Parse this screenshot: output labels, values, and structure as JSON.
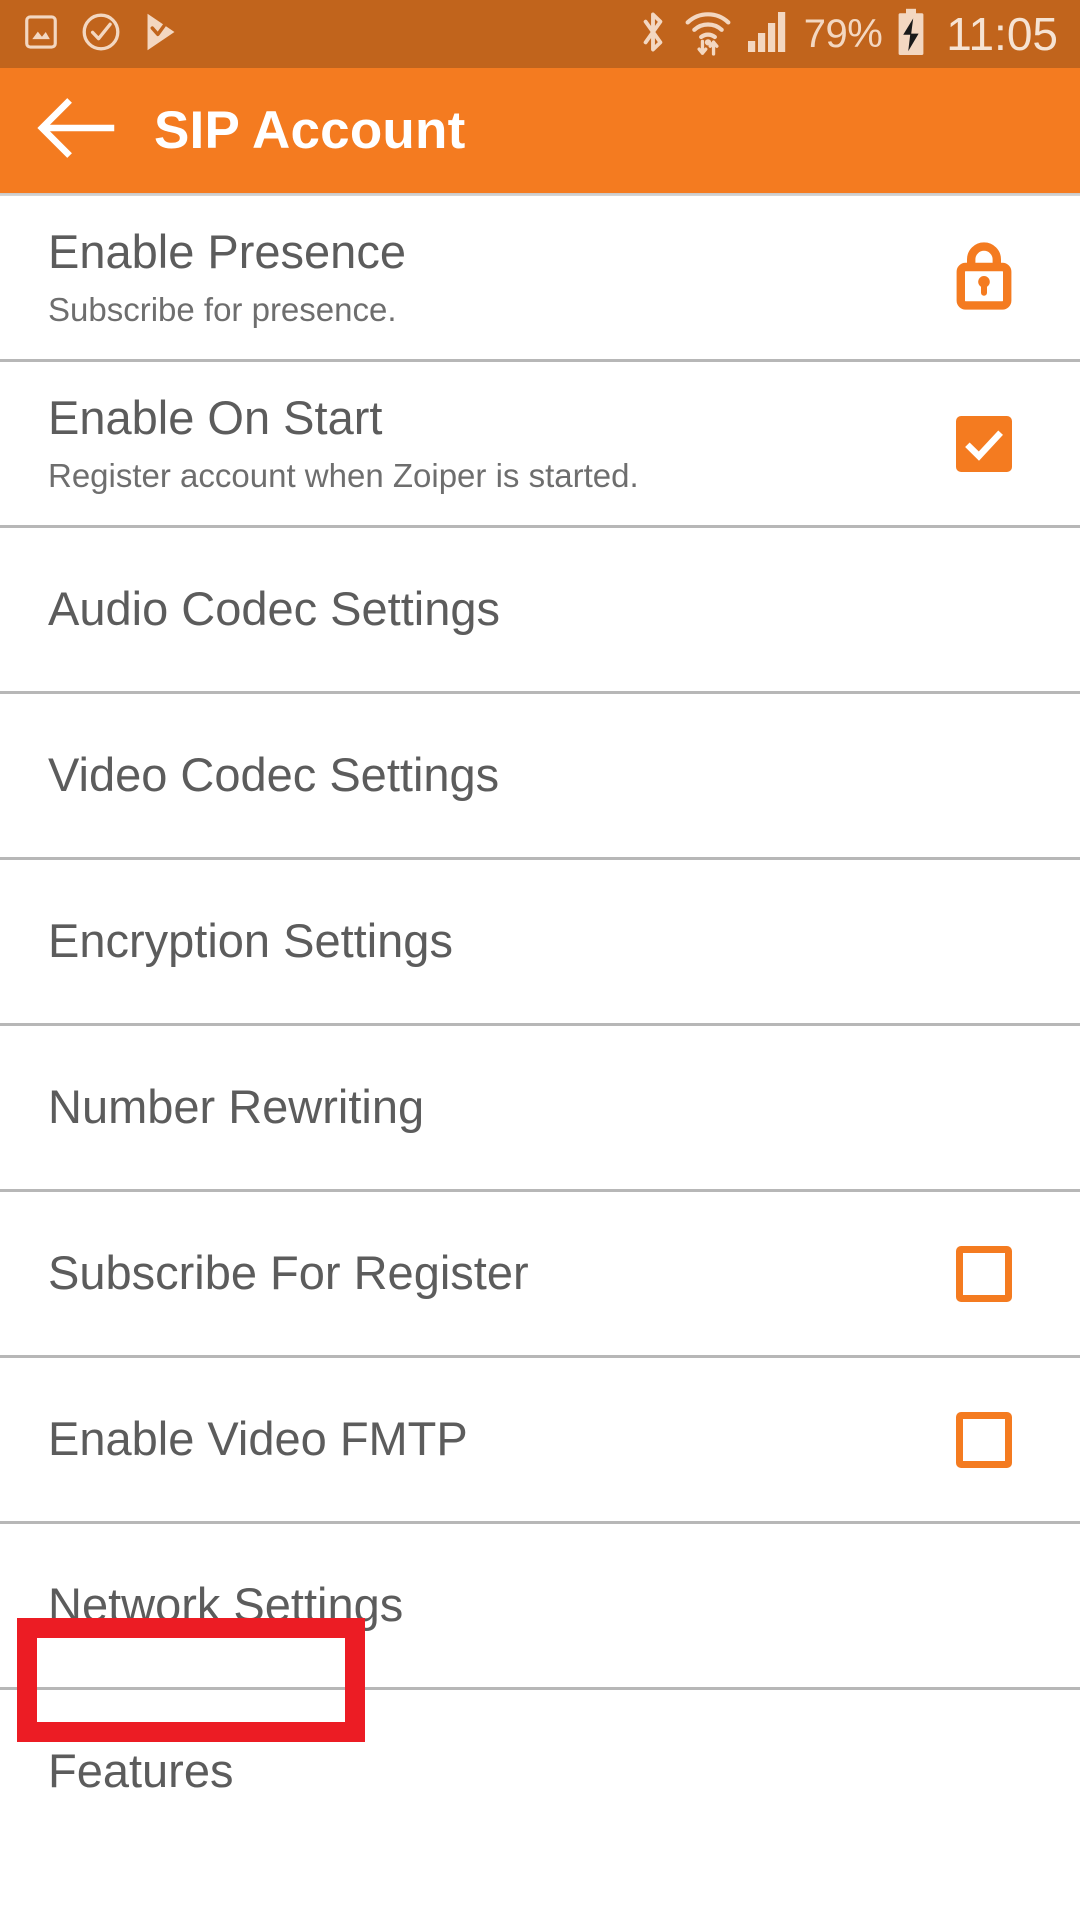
{
  "status_bar": {
    "background_color": "#c1641c",
    "icons_left": [
      "image-icon",
      "check-circle-icon",
      "play-store-check-icon"
    ],
    "icons_right": [
      "bluetooth-icon",
      "wifi-icon",
      "signal-bars-icon",
      "battery-charging-icon"
    ],
    "battery_percent": "79%",
    "clock": "11:05"
  },
  "app_bar": {
    "background_color": "#f47b20",
    "back_icon": "arrow-left-icon",
    "title": "SIP Account"
  },
  "accent_color": "#f47b20",
  "highlight_color": "#ec1c24",
  "settings": {
    "rows": [
      {
        "title": "Enable Presence",
        "subtitle": "Subscribe for presence.",
        "accessory": "lock",
        "locked": true
      },
      {
        "title": "Enable On Start",
        "subtitle": "Register account when Zoiper is started.",
        "accessory": "checkbox",
        "checked": true
      },
      {
        "title": "Audio Codec Settings",
        "subtitle": "",
        "accessory": "none",
        "checked": false
      },
      {
        "title": "Video Codec Settings",
        "subtitle": "",
        "accessory": "none",
        "checked": false
      },
      {
        "title": "Encryption Settings",
        "subtitle": "",
        "accessory": "none",
        "checked": false
      },
      {
        "title": "Number Rewriting",
        "subtitle": "",
        "accessory": "none",
        "checked": false
      },
      {
        "title": "Subscribe For Register",
        "subtitle": "",
        "accessory": "checkbox",
        "checked": false
      },
      {
        "title": "Enable Video FMTP",
        "subtitle": "",
        "accessory": "checkbox",
        "checked": false
      },
      {
        "title": "Network Settings",
        "subtitle": "",
        "accessory": "none",
        "checked": false,
        "highlighted": true
      },
      {
        "title": "Features",
        "subtitle": "",
        "accessory": "none",
        "checked": false
      }
    ]
  }
}
